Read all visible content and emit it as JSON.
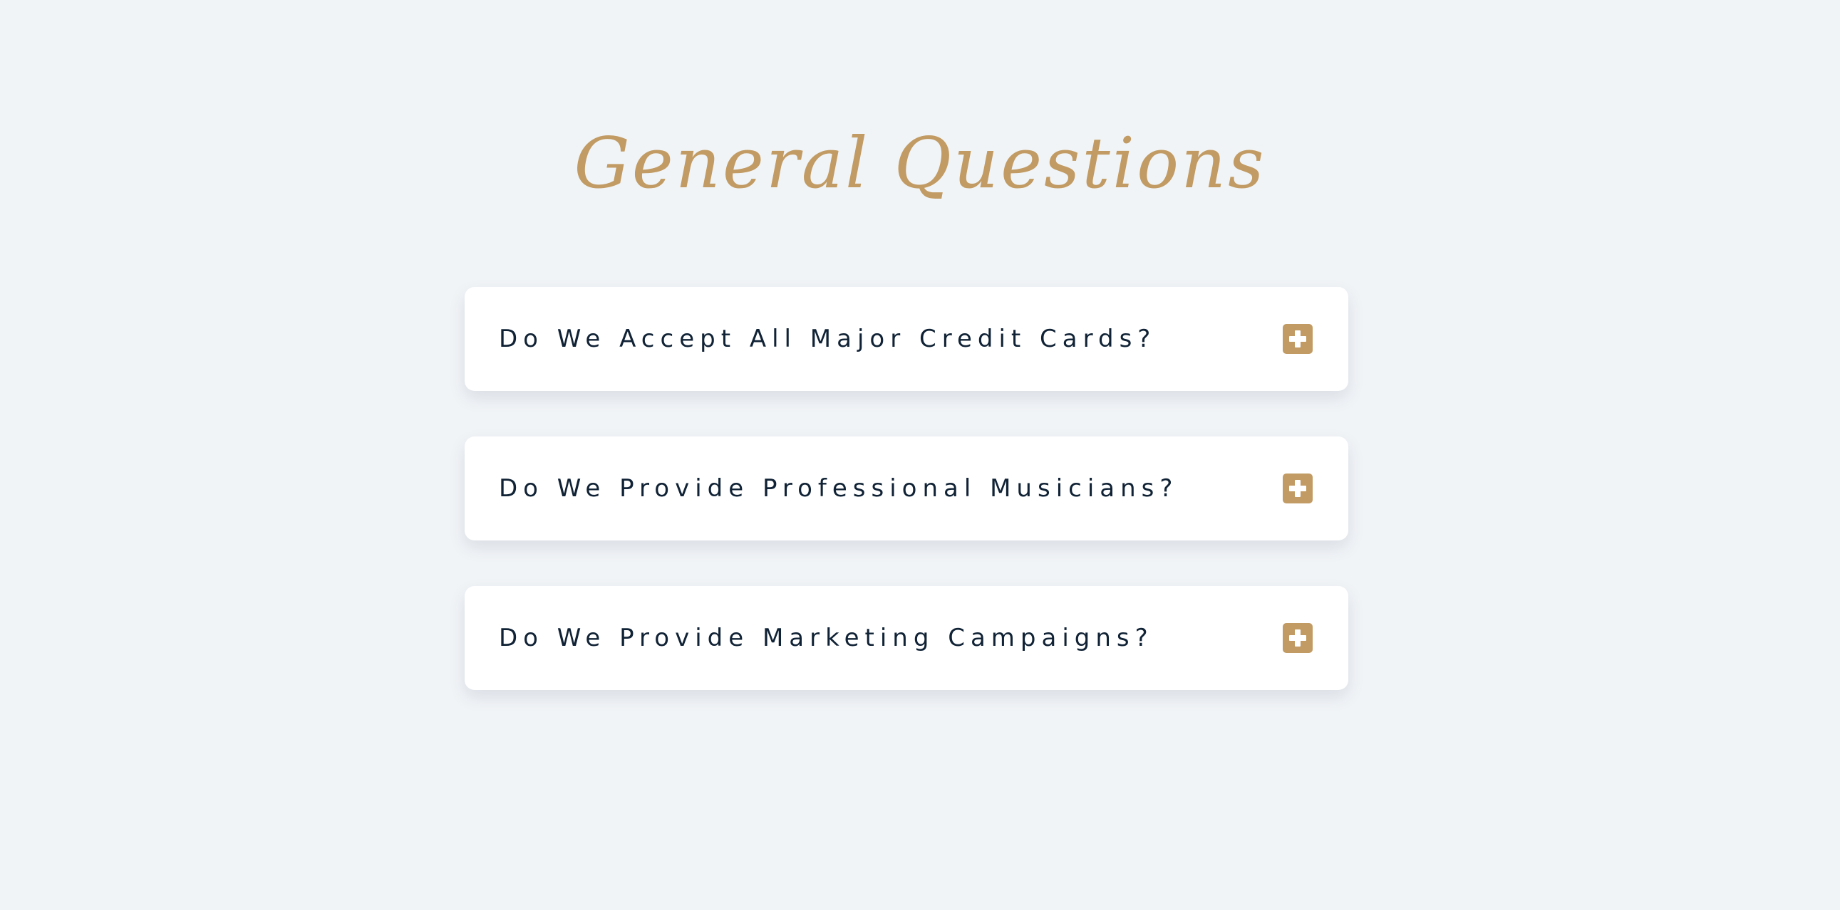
{
  "page": {
    "title": "General Questions"
  },
  "faq": {
    "items": [
      {
        "question": "Do We Accept All Major Credit Cards?",
        "toggle_icon": "plus-square-icon"
      },
      {
        "question": "Do We Provide Professional Musicians?",
        "toggle_icon": "plus-square-icon"
      },
      {
        "question": "Do We Provide Marketing Campaigns?",
        "toggle_icon": "plus-square-icon"
      }
    ]
  },
  "colors": {
    "background": "#f1f4f7",
    "accent": "#c19b63",
    "card": "#ffffff",
    "text": "#102235"
  }
}
